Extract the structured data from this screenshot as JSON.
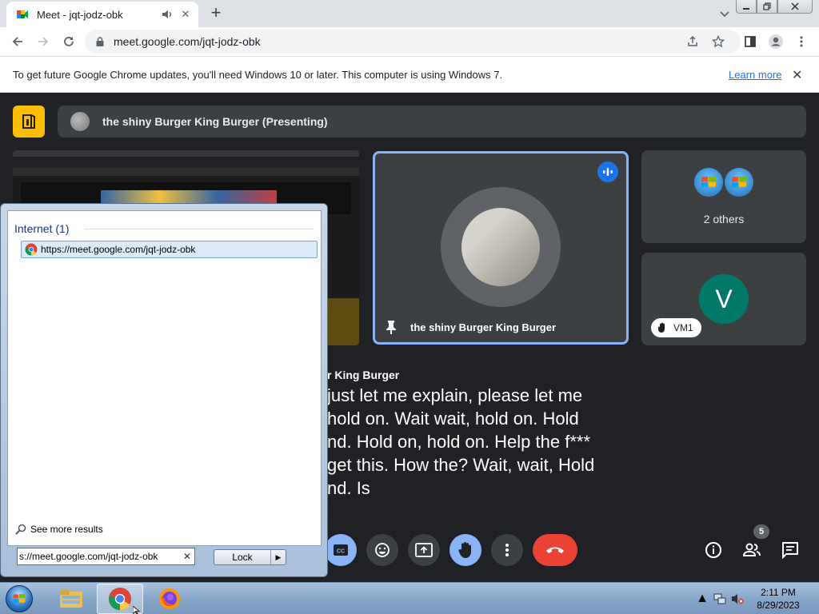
{
  "browser": {
    "tab_title": "Meet - jqt-jodz-obk",
    "url": "meet.google.com/jqt-jodz-obk",
    "new_tab_symbol": "+",
    "tab_close_symbol": "✕"
  },
  "infobar": {
    "message": "To get future Google Chrome updates, you'll need Windows 10 or later. This computer is using Windows 7.",
    "link": "Learn more",
    "close_symbol": "✕"
  },
  "meet": {
    "presenting_label": "the shiny Burger King Burger (Presenting)",
    "speaker_name": "the shiny Burger King Burger",
    "others_label": "2 others",
    "vm_initial": "V",
    "vm_name": "VM1",
    "caption_speaker": "r King Burger",
    "caption_lines": [
      "just let me explain, please let me",
      "hold on. Wait wait, hold on. Hold",
      "nd. Hold on, hold on. Help the f***",
      "get this. How the? Wait, wait, Hold",
      "nd. Is"
    ],
    "people_count": "5",
    "accent_color": "#8ab4f8",
    "end_call_color": "#ea4335"
  },
  "start_menu": {
    "heading": "Internet (1)",
    "result": "https://meet.google.com/jqt-jodz-obk",
    "see_more": "See more results",
    "search_value": "s://meet.google.com/jqt-jodz-obk",
    "clear_symbol": "✕",
    "lock_label": "Lock",
    "lock_arrow": "▶"
  },
  "taskbar": {
    "time": "2:11 PM",
    "date": "8/29/2023",
    "tray_arrow": "▲"
  },
  "icons": [
    "meet-favicon",
    "audio-icon",
    "back-icon",
    "forward-icon",
    "reload-icon",
    "lock-icon",
    "share-icon",
    "star-icon",
    "sidepanel-icon",
    "profile-icon",
    "menu-icon",
    "meet-logo-icon",
    "pin-icon",
    "audio-level-icon",
    "hand-icon",
    "captions-icon",
    "emoji-icon",
    "present-icon",
    "raise-hand-icon",
    "more-options-icon",
    "end-call-icon",
    "info-icon",
    "people-icon",
    "chat-icon",
    "chrome-icon",
    "search-icon",
    "windows-orb-icon",
    "explorer-icon",
    "firefox-icon",
    "network-icon",
    "volume-muted-icon"
  ]
}
